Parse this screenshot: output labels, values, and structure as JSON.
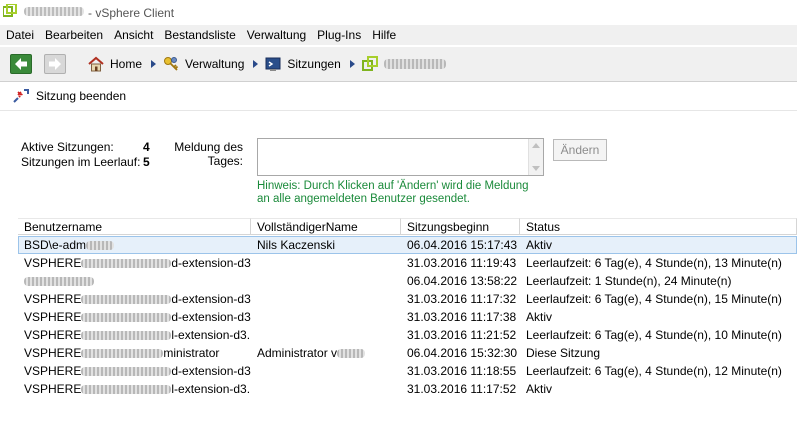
{
  "window": {
    "title": "- vSphere Client"
  },
  "menu": [
    "Datei",
    "Bearbeiten",
    "Ansicht",
    "Bestandsliste",
    "Verwaltung",
    "Plug-Ins",
    "Hilfe"
  ],
  "breadcrumb": {
    "home": "Home",
    "admin": "Verwaltung",
    "sessions": "Sitzungen"
  },
  "toolbar": {
    "end_session": "Sitzung beenden"
  },
  "summary": {
    "active_label": "Aktive Sitzungen:",
    "active_value": "4",
    "idle_label": "Sitzungen im Leerlauf:",
    "idle_value": "5"
  },
  "motd": {
    "label": "Meldung des Tages:",
    "value": "",
    "change_label": "Ändern",
    "hint": "Hinweis: Durch Klicken auf 'Ändern' wird die Meldung an alle angemeldeten Benutzer gesendet."
  },
  "table": {
    "columns": [
      "Benutzername",
      "VollständigerName",
      "Sitzungsbeginn",
      "Status"
    ],
    "rows": [
      {
        "user_prefix": "BSD\\e-adm",
        "user_suffix": "",
        "full_name": "Nils Kaczenski",
        "start": "06.04.2016 15:17:43",
        "status": "Aktiv",
        "selected": true
      },
      {
        "user_prefix": "VSPHERE",
        "user_suffix": "d-extension-d3...",
        "full_name": "",
        "start": "31.03.2016 11:19:43",
        "status": "Leerlaufzeit: 6 Tag(e), 4 Stunde(n), 13 Minute(n)"
      },
      {
        "user_prefix": "",
        "user_suffix": "",
        "full_name": "",
        "start": "06.04.2016 13:58:22",
        "status": "Leerlaufzeit: 1 Stunde(n), 24 Minute(n)"
      },
      {
        "user_prefix": "VSPHERE",
        "user_suffix": "d-extension-d3...",
        "full_name": "",
        "start": "31.03.2016 11:17:32",
        "status": "Leerlaufzeit: 6 Tag(e), 4 Stunde(n), 15 Minute(n)"
      },
      {
        "user_prefix": "VSPHERE",
        "user_suffix": "d-extension-d3...",
        "full_name": "",
        "start": "31.03.2016 11:17:38",
        "status": "Aktiv"
      },
      {
        "user_prefix": "VSPHERE",
        "user_suffix": "l-extension-d3...",
        "full_name": "",
        "start": "31.03.2016 11:21:52",
        "status": "Leerlaufzeit: 6 Tag(e), 4 Stunde(n), 10 Minute(n)"
      },
      {
        "user_prefix": "VSPHERE",
        "user_suffix": "ministrator",
        "full_name": "Administrator v",
        "start": "06.04.2016 15:32:30",
        "status": "Diese Sitzung"
      },
      {
        "user_prefix": "VSPHERE",
        "user_suffix": "d-extension-d3...",
        "full_name": "",
        "start": "31.03.2016 11:18:55",
        "status": "Leerlaufzeit: 6 Tag(e), 4 Stunde(n), 12 Minute(n)"
      },
      {
        "user_prefix": "VSPHERE",
        "user_suffix": "l-extension-d3...",
        "full_name": "",
        "start": "31.03.2016 11:17:52",
        "status": "Aktiv"
      }
    ]
  },
  "icons": {
    "app": "vsphere-logo-icon",
    "back": "arrow-left-icon",
    "forward": "arrow-right-icon",
    "home": "home-icon",
    "admin": "admin-keys-icon",
    "sessions": "sessions-console-icon",
    "server": "vcenter-server-icon",
    "end_session": "disconnect-icon"
  },
  "colors": {
    "hint": "#1a8a3a",
    "selected_row": "#e6f0fa",
    "back_button": "#3a8a3a"
  }
}
